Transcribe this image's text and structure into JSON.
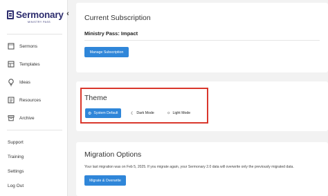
{
  "sidebar": {
    "logo": "Sermonary",
    "logo_sub": "MINISTRY PASS",
    "collapse_icon": "chevron-left",
    "nav": [
      {
        "label": "Sermons",
        "icon": "square-icon"
      },
      {
        "label": "Templates",
        "icon": "template-icon"
      },
      {
        "label": "Ideas",
        "icon": "lightbulb-icon"
      },
      {
        "label": "Resources",
        "icon": "resources-icon"
      },
      {
        "label": "Archive",
        "icon": "archive-icon"
      }
    ],
    "bottom": [
      "Support",
      "Training",
      "Settings",
      "Log Out"
    ]
  },
  "subscription": {
    "title": "Current Subscription",
    "plan": "Ministry Pass: Impact",
    "manage_label": "Manage Subscription"
  },
  "theme": {
    "title": "Theme",
    "options": [
      {
        "label": "System Default",
        "icon": "gear-icon",
        "active": true
      },
      {
        "label": "Dark Mode",
        "icon": "moon-icon",
        "active": false
      },
      {
        "label": "Light Mode",
        "icon": "sun-icon",
        "active": false
      }
    ]
  },
  "migration": {
    "title": "Migration Options",
    "text": "Your last migration was on Feb 5, 2025. If you migrate again, your Sermonary 2.0 data will overwrite only the previously migrated data.",
    "button_label": "Migrate & Overwrite"
  },
  "colors": {
    "accent": "#2f86d9",
    "highlight": "#d9362b",
    "brand": "#2d2d6e"
  }
}
